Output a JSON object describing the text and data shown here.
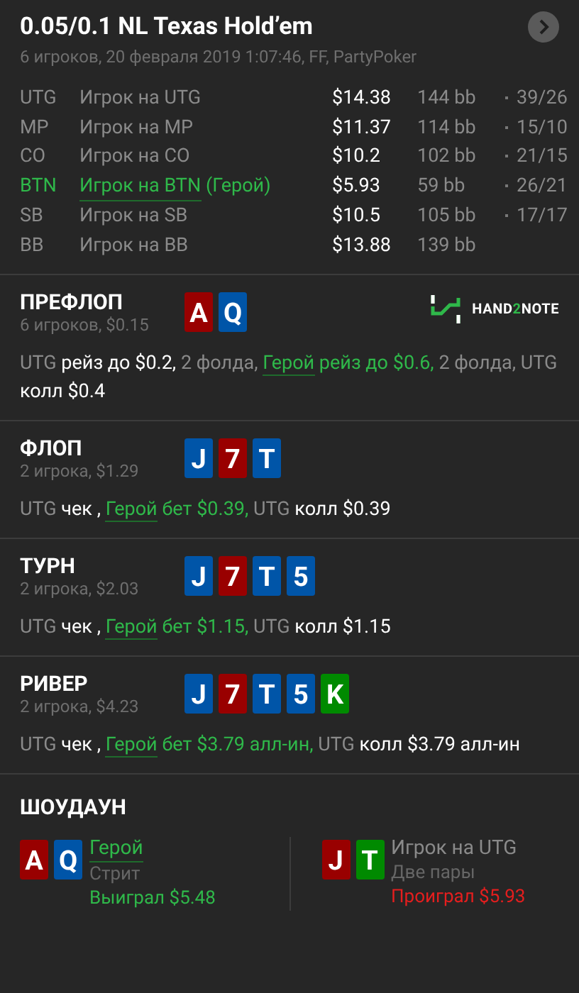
{
  "header": {
    "title": "0.05/0.1 NL Texas Hold’em",
    "subtitle": "6 игроков, 20 февраля 2019 1:07:46, FF, PartyPoker"
  },
  "players": [
    {
      "position": "UTG",
      "name": "Игрок на UTG",
      "hero": false,
      "stack": "$14.38",
      "bb": "144 bb",
      "stats": "39/26"
    },
    {
      "position": "MP",
      "name": "Игрок на MP",
      "hero": false,
      "stack": "$11.37",
      "bb": "114 bb",
      "stats": "15/10"
    },
    {
      "position": "CO",
      "name": "Игрок на CO",
      "hero": false,
      "stack": "$10.2",
      "bb": "102 bb",
      "stats": "21/15"
    },
    {
      "position": "BTN",
      "name": "Игрок на BTN",
      "hero": true,
      "hero_tag": "(Герой)",
      "stack": "$5.93",
      "bb": "59 bb",
      "stats": "26/21"
    },
    {
      "position": "SB",
      "name": "Игрок на SB",
      "hero": false,
      "stack": "$10.5",
      "bb": "105 bb",
      "stats": "17/17"
    },
    {
      "position": "BB",
      "name": "Игрок на BB",
      "hero": false,
      "stack": "$13.88",
      "bb": "139 bb"
    }
  ],
  "logo": [
    "HAND",
    "2",
    "NOTE"
  ],
  "streets": [
    {
      "name": "ПРЕФЛОП",
      "summary": "6 игроков, $0.15",
      "logo": true,
      "cards": [
        {
          "rank": "A",
          "color": "#990000"
        },
        {
          "rank": "Q",
          "color": "#0055a8"
        }
      ],
      "actions": [
        {
          "kind": "pos",
          "text": "UTG"
        },
        {
          "kind": "act",
          "text": " рейз до $0.2,"
        },
        {
          "kind": "plain",
          "text": " 2 фолда, "
        },
        {
          "kind": "hero",
          "text": "Герой"
        },
        {
          "kind": "heroact",
          "text": " рейз до $0.6,"
        },
        {
          "kind": "plain",
          "text": " 2 фолда, UTG"
        },
        {
          "kind": "act",
          "text": " колл $0.4"
        }
      ]
    },
    {
      "name": "ФЛОП",
      "summary": "2 игрока, $1.29",
      "logo": false,
      "cards": [
        {
          "rank": "J",
          "color": "#0055a8"
        },
        {
          "rank": "7",
          "color": "#990000"
        },
        {
          "rank": "T",
          "color": "#0055a8"
        }
      ],
      "actions": [
        {
          "kind": "pos",
          "text": "UTG"
        },
        {
          "kind": "act",
          "text": " чек , "
        },
        {
          "kind": "hero",
          "text": "Герой"
        },
        {
          "kind": "heroact",
          "text": " бет $0.39,"
        },
        {
          "kind": "plain",
          "text": " UTG"
        },
        {
          "kind": "act",
          "text": " колл $0.39"
        }
      ]
    },
    {
      "name": "ТУРН",
      "summary": "2 игрока, $2.03",
      "logo": false,
      "cards": [
        {
          "rank": "J",
          "color": "#0055a8"
        },
        {
          "rank": "7",
          "color": "#990000"
        },
        {
          "rank": "T",
          "color": "#0055a8"
        },
        {
          "rank": "5",
          "color": "#0055a8"
        }
      ],
      "actions": [
        {
          "kind": "pos",
          "text": "UTG"
        },
        {
          "kind": "act",
          "text": " чек , "
        },
        {
          "kind": "hero",
          "text": "Герой"
        },
        {
          "kind": "heroact",
          "text": " бет $1.15,"
        },
        {
          "kind": "plain",
          "text": " UTG"
        },
        {
          "kind": "act",
          "text": " колл $1.15"
        }
      ]
    },
    {
      "name": "РИВЕР",
      "summary": "2 игрока, $4.23",
      "logo": false,
      "cards": [
        {
          "rank": "J",
          "color": "#0055a8"
        },
        {
          "rank": "7",
          "color": "#990000"
        },
        {
          "rank": "T",
          "color": "#0055a8"
        },
        {
          "rank": "5",
          "color": "#0055a8"
        },
        {
          "rank": "K",
          "color": "#008a00"
        }
      ],
      "actions": [
        {
          "kind": "pos",
          "text": "UTG"
        },
        {
          "kind": "act",
          "text": " чек , "
        },
        {
          "kind": "hero",
          "text": "Герой"
        },
        {
          "kind": "heroact",
          "text": " бет $3.79 алл-ин,"
        },
        {
          "kind": "plain",
          "text": " UTG"
        },
        {
          "kind": "act",
          "text": " колл $3.79 алл-ин"
        }
      ]
    }
  ],
  "showdown": {
    "title": "ШОУДАУН",
    "hands": [
      {
        "name": "Герой",
        "hero": true,
        "hand": "Стрит",
        "result": "Выиграл $5.48",
        "won": true,
        "cards": [
          {
            "rank": "A",
            "color": "#990000"
          },
          {
            "rank": "Q",
            "color": "#0055a8"
          }
        ]
      },
      {
        "name": "Игрок на UTG",
        "hero": false,
        "hand": "Две пары",
        "result": "Проиграл $5.93",
        "won": false,
        "cards": [
          {
            "rank": "J",
            "color": "#990000"
          },
          {
            "rank": "T",
            "color": "#008a00"
          }
        ]
      }
    ]
  }
}
